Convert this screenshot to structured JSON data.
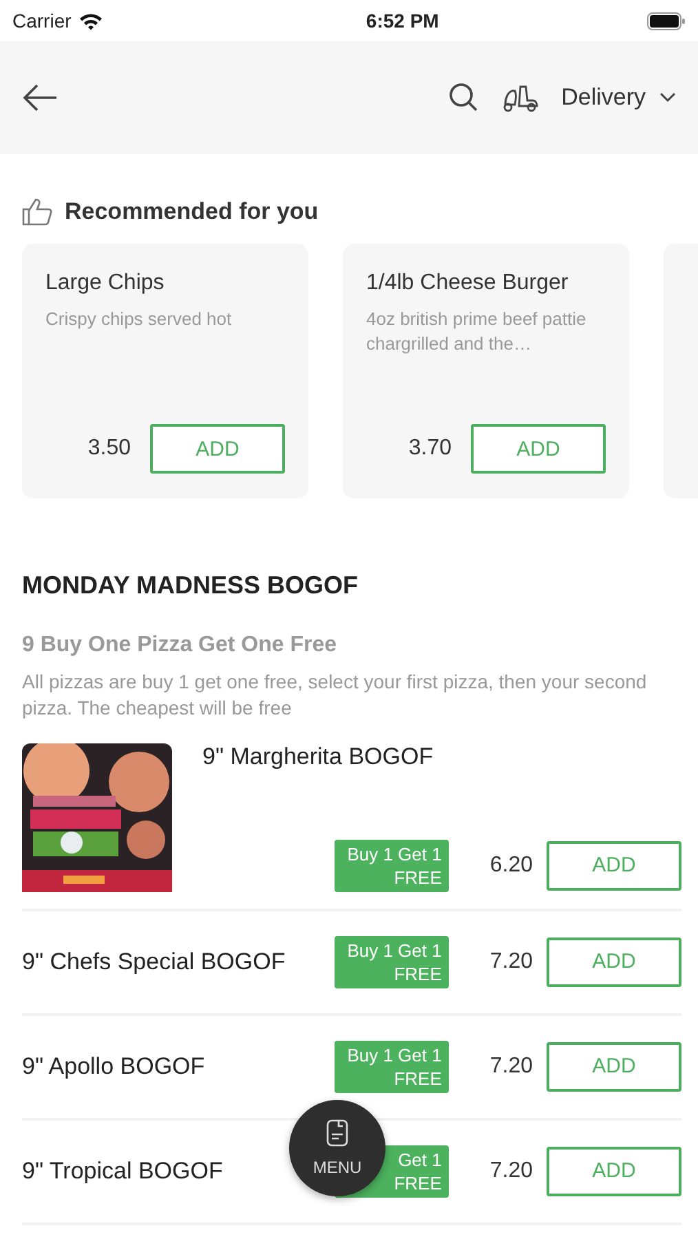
{
  "status_bar": {
    "carrier": "Carrier",
    "time": "6:52 PM"
  },
  "header": {
    "delivery_mode": "Delivery"
  },
  "recommended": {
    "title": "Recommended for you",
    "items": [
      {
        "name": "Large Chips",
        "description": "Crispy chips served hot",
        "price": "3.50",
        "button": "ADD"
      },
      {
        "name": "1/4lb Cheese Burger",
        "description": "4oz british prime beef pattie chargrilled and the…",
        "price": "3.70",
        "button": "ADD"
      }
    ]
  },
  "section": {
    "title": "MONDAY MADNESS BOGOF",
    "subtitle": "9 Buy One Pizza Get One Free",
    "description": "All pizzas are buy 1 get one free, select your first pizza, then your second pizza. The cheapest will be free",
    "items": [
      {
        "name": "9\" Margherita BOGOF",
        "badge": "Buy 1 Get 1 FREE",
        "price": "6.20",
        "button": "ADD"
      },
      {
        "name": "9\" Chefs Special BOGOF",
        "badge": "Buy 1 Get 1 FREE",
        "price": "7.20",
        "button": "ADD"
      },
      {
        "name": "9\" Apollo BOGOF",
        "badge": "Buy 1 Get 1 FREE",
        "price": "7.20",
        "button": "ADD"
      },
      {
        "name": "9\" Tropical BOGOF",
        "badge": "Get 1\nFREE",
        "price": "7.20",
        "button": "ADD"
      }
    ]
  },
  "menu_button": {
    "label": "MENU"
  }
}
